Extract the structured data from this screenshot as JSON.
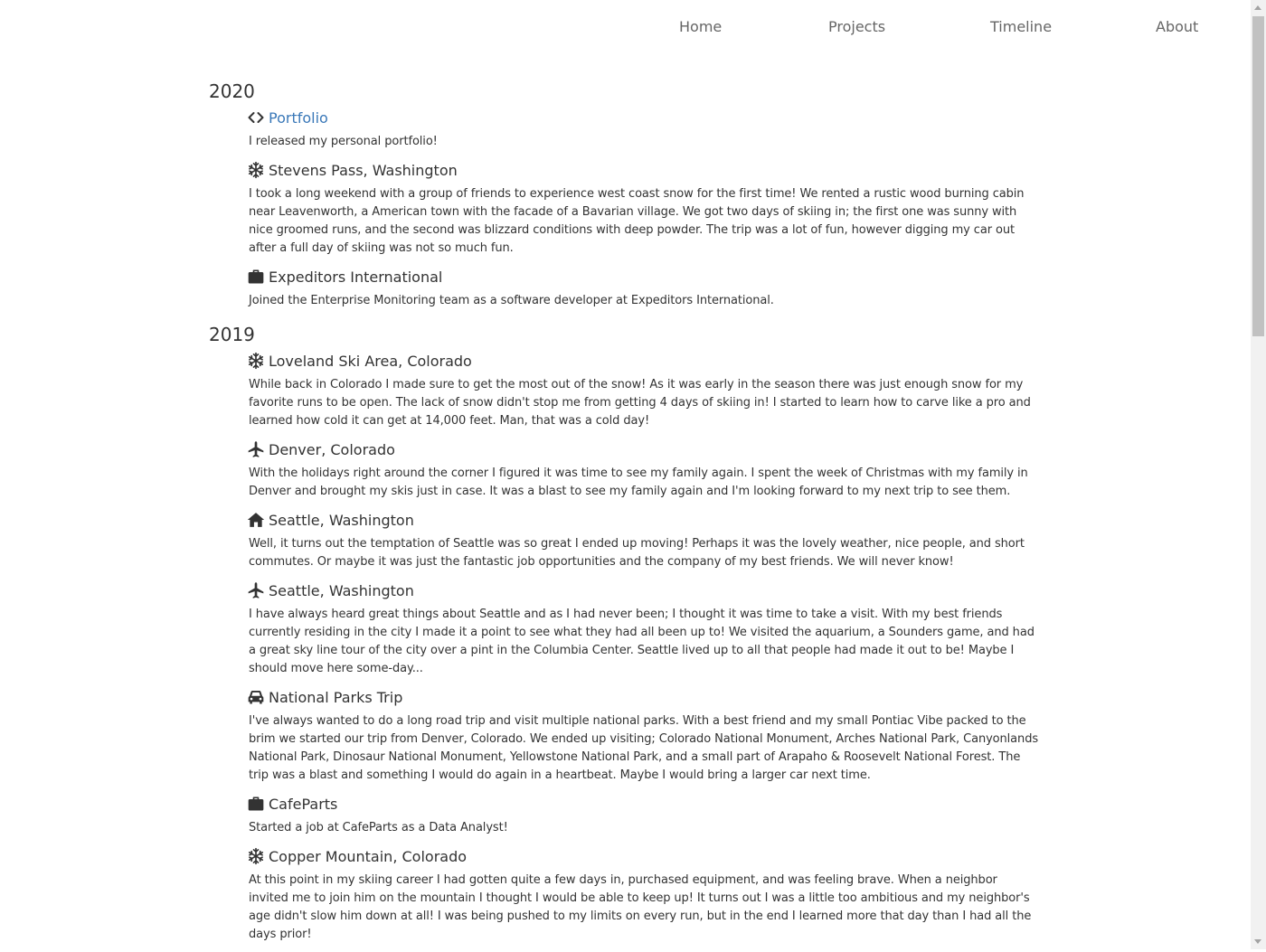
{
  "nav": {
    "items": [
      {
        "label": "Home"
      },
      {
        "label": "Projects"
      },
      {
        "label": "Timeline"
      },
      {
        "label": "About"
      }
    ]
  },
  "timeline": [
    {
      "year": "2020",
      "entries": [
        {
          "icon": "code-icon",
          "title": "Portfolio",
          "link": true,
          "desc": "I released my personal portfolio!"
        },
        {
          "icon": "snowflake-icon",
          "title": "Stevens Pass, Washington",
          "link": false,
          "desc": "I took a long weekend with a group of friends to experience west coast snow for the first time! We rented a rustic wood burning cabin near Leavenworth, a American town with the facade of a Bavarian village. We got two days of skiing in; the first one was sunny with nice groomed runs, and the second was blizzard conditions with deep powder. The trip was a lot of fun, however digging my car out after a full day of skiing was not so much fun."
        },
        {
          "icon": "briefcase-icon",
          "title": "Expeditors International",
          "link": false,
          "desc": "Joined the Enterprise Monitoring team as a software developer at Expeditors International."
        }
      ]
    },
    {
      "year": "2019",
      "entries": [
        {
          "icon": "snowflake-icon",
          "title": "Loveland Ski Area, Colorado",
          "link": false,
          "desc": "While back in Colorado I made sure to get the most out of the snow! As it was early in the season there was just enough snow for my favorite runs to be open. The lack of snow didn't stop me from getting 4 days of skiing in! I started to learn how to carve like a pro and learned how cold it can get at 14,000 feet. Man, that was a cold day!"
        },
        {
          "icon": "plane-icon",
          "title": "Denver, Colorado",
          "link": false,
          "desc": "With the holidays right around the corner I figured it was time to see my family again. I spent the week of Christmas with my family in Denver and brought my skis just in case. It was a blast to see my family again and I'm looking forward to my next trip to see them."
        },
        {
          "icon": "home-icon",
          "title": "Seattle, Washington",
          "link": false,
          "desc": "Well, it turns out the temptation of Seattle was so great I ended up moving! Perhaps it was the lovely weather, nice people, and short commutes. Or maybe it was just the fantastic job opportunities and the company of my best friends. We will never know!"
        },
        {
          "icon": "plane-icon",
          "title": "Seattle, Washington",
          "link": false,
          "desc": "I have always heard great things about Seattle and as I had never been; I thought it was time to take a visit. With my best friends currently residing in the city I made it a point to see what they had all been up to! We visited the aquarium, a Sounders game, and had a great sky line tour of the city over a pint in the Columbia Center. Seattle lived up to all that people had made it out to be! Maybe I should move here some-day..."
        },
        {
          "icon": "car-icon",
          "title": "National Parks Trip",
          "link": false,
          "desc": "I've always wanted to do a long road trip and visit multiple national parks. With a best friend and my small Pontiac Vibe packed to the brim we started our trip from Denver, Colorado. We ended up visiting; Colorado National Monument, Arches National Park, Canyonlands National Park, Dinosaur National Monument, Yellowstone National Park, and a small part of Arapaho & Roosevelt National Forest. The trip was a blast and something I would do again in a heartbeat. Maybe I would bring a larger car next time."
        },
        {
          "icon": "briefcase-icon",
          "title": "CafeParts",
          "link": false,
          "desc": "Started a job at CafeParts as a Data Analyst!"
        },
        {
          "icon": "snowflake-icon",
          "title": "Copper Mountain, Colorado",
          "link": false,
          "desc": "At this point in my skiing career I had gotten quite a few days in, purchased equipment, and was feeling brave. When a neighbor invited me to join him on the mountain I thought I would be able to keep up! It turns out I was a little too ambitious and my neighbor's age didn't slow him down at all! I was being pushed to my limits on every run, but in the end I learned more that day than I had all the days prior!"
        }
      ]
    }
  ],
  "colors": {
    "text": "#333333",
    "nav": "#666666",
    "link": "#3a78b8",
    "icon": "#333333"
  }
}
